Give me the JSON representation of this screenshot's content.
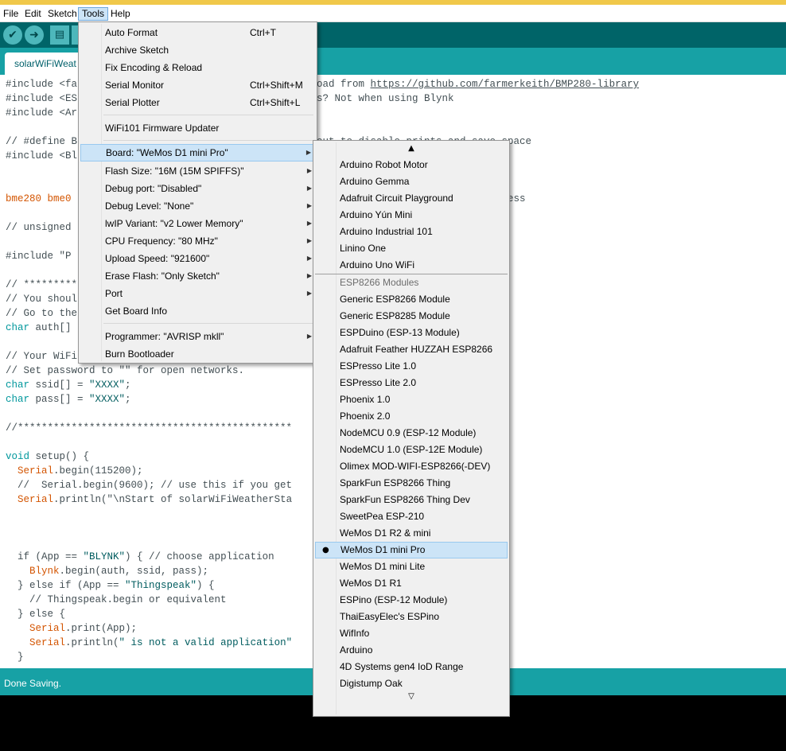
{
  "menubar": {
    "items": [
      {
        "label": "File"
      },
      {
        "label": "Edit"
      },
      {
        "label": "Sketch"
      },
      {
        "label": "Tools"
      },
      {
        "label": "Help"
      }
    ]
  },
  "toolbar": {
    "icons": [
      "verify-icon",
      "upload-icon",
      "new-icon",
      "open-icon"
    ]
  },
  "tab": {
    "label": "solarWiFiWeat"
  },
  "editor": {
    "lines": [
      {
        "pre": "#include <fa",
        "mid": "",
        "post": "oad from ",
        "link": "https://github.com/farmerkeith/BMP280-library"
      },
      {
        "text1": "#include <ES",
        "text2": "s? Not when using Blynk"
      },
      {
        "text1": "#include <Ar"
      },
      {
        "text1": "// #define B",
        "text2": "out to disable prints and save space"
      },
      {
        "text1": "#include <Bl"
      },
      {
        "text1": "bme280 bme0",
        "text2": "ess"
      },
      {
        "text1": "// unsigned"
      },
      {
        "text1": "#include \"P"
      },
      {
        "text1": "// *********"
      },
      {
        "text1": "// You shoul"
      },
      {
        "text1": "// Go to the"
      },
      {
        "text1": "auth[]"
      },
      {
        "text1": "// Your WiFi"
      },
      {
        "text1": "// Set password to \"\" for open networks."
      },
      {
        "text1": " ssid[] = ",
        "str": "\"XXXX\"",
        "end": ";"
      },
      {
        "text1": " pass[] = ",
        "str": "\"XXXX\"",
        "end": ";"
      },
      {
        "text1": "//**********************************************"
      },
      {
        "text1": " setup() {"
      },
      {
        "text1": ".begin(115200);"
      },
      {
        "text1": "  //  Serial.begin(9600); // use this if you get"
      },
      {
        "text1": ".println(\"\\nStart of solarWiFiWeatherSta"
      },
      {
        "text1": "  if (App == ",
        "str": "\"BLYNK\"",
        "end": ") { // choose application"
      },
      {
        "text1": ".begin(auth, ssid, pass);"
      },
      {
        "text1": "  } else if (App == ",
        "str": "\"Thingspeak\"",
        "end": ") {"
      },
      {
        "text1": "    // Thingspeak.begin or equivalent"
      },
      {
        "text1": "  } else {"
      },
      {
        "text1": ".print(App);"
      },
      {
        "text1": ".println(",
        "str": "\" is not a valid application\""
      },
      {
        "text1": "  }"
      }
    ],
    "kw_char": "char",
    "kw_void": "void",
    "fn_serial": "Serial",
    "fn_blynk": "Blynk"
  },
  "status": {
    "text": "Done Saving."
  },
  "tools_menu": {
    "items": [
      {
        "label": "Auto Format",
        "shortcut": "Ctrl+T"
      },
      {
        "label": "Archive Sketch",
        "shortcut": ""
      },
      {
        "label": "Fix Encoding & Reload",
        "shortcut": ""
      },
      {
        "label": "Serial Monitor",
        "shortcut": "Ctrl+Shift+M"
      },
      {
        "label": "Serial Plotter",
        "shortcut": "Ctrl+Shift+L"
      },
      {
        "label": "WiFi101 Firmware Updater",
        "shortcut": ""
      },
      {
        "label": "Board: \"WeMos D1 mini Pro\"",
        "shortcut": ""
      },
      {
        "label": "Flash Size: \"16M (15M SPIFFS)\"",
        "shortcut": ""
      },
      {
        "label": "Debug port: \"Disabled\"",
        "shortcut": ""
      },
      {
        "label": "Debug Level: \"None\"",
        "shortcut": ""
      },
      {
        "label": "lwIP Variant: \"v2 Lower Memory\"",
        "shortcut": ""
      },
      {
        "label": "CPU Frequency: \"80 MHz\"",
        "shortcut": ""
      },
      {
        "label": "Upload Speed: \"921600\"",
        "shortcut": ""
      },
      {
        "label": "Erase Flash: \"Only Sketch\"",
        "shortcut": ""
      },
      {
        "label": "Port",
        "shortcut": ""
      },
      {
        "label": "Get Board Info",
        "shortcut": ""
      },
      {
        "label": "Programmer: \"AVRISP mkll\"",
        "shortcut": ""
      },
      {
        "label": "Burn Bootloader",
        "shortcut": ""
      }
    ]
  },
  "board_menu": {
    "scroll_up": "▲",
    "scroll_down": "▽",
    "selected_bullet": "●",
    "items": [
      {
        "label": "Arduino Robot Motor"
      },
      {
        "label": "Arduino Gemma"
      },
      {
        "label": "Adafruit Circuit Playground"
      },
      {
        "label": "Arduino Yún Mini"
      },
      {
        "label": "Arduino Industrial 101"
      },
      {
        "label": "Linino One"
      },
      {
        "label": "Arduino Uno WiFi"
      },
      {
        "label": "ESP8266 Modules"
      },
      {
        "label": "Generic ESP8266 Module"
      },
      {
        "label": "Generic ESP8285 Module"
      },
      {
        "label": "ESPDuino (ESP-13 Module)"
      },
      {
        "label": "Adafruit Feather HUZZAH ESP8266"
      },
      {
        "label": "ESPresso Lite 1.0"
      },
      {
        "label": "ESPresso Lite 2.0"
      },
      {
        "label": "Phoenix 1.0"
      },
      {
        "label": "Phoenix 2.0"
      },
      {
        "label": "NodeMCU 0.9 (ESP-12 Module)"
      },
      {
        "label": "NodeMCU 1.0 (ESP-12E Module)"
      },
      {
        "label": "Olimex MOD-WIFI-ESP8266(-DEV)"
      },
      {
        "label": "SparkFun ESP8266 Thing"
      },
      {
        "label": "SparkFun ESP8266 Thing Dev"
      },
      {
        "label": "SweetPea ESP-210"
      },
      {
        "label": "WeMos D1 R2 & mini"
      },
      {
        "label": "WeMos D1 mini Pro"
      },
      {
        "label": "WeMos D1 mini Lite"
      },
      {
        "label": "WeMos D1 R1"
      },
      {
        "label": "ESPino (ESP-12 Module)"
      },
      {
        "label": "ThaiEasyElec's ESPino"
      },
      {
        "label": "WifInfo"
      },
      {
        "label": "Arduino"
      },
      {
        "label": "4D Systems gen4 IoD Range"
      },
      {
        "label": "Digistump Oak"
      }
    ]
  }
}
